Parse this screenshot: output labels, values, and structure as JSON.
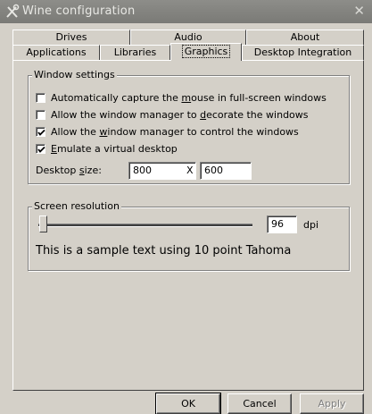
{
  "window": {
    "title": "Wine configuration",
    "close_glyph": "✕"
  },
  "tabs_row1": [
    {
      "label": "Drives"
    },
    {
      "label": "Audio"
    },
    {
      "label": "About"
    }
  ],
  "tabs_row2": [
    {
      "label": "Applications"
    },
    {
      "label": "Libraries"
    },
    {
      "label": "Graphics",
      "selected": true
    },
    {
      "label": "Desktop Integration"
    }
  ],
  "window_settings": {
    "title": "Window settings",
    "options": [
      {
        "before": "Automatically capture the ",
        "accel": "m",
        "after": "ouse in full-screen windows",
        "checked": false
      },
      {
        "before": "Allow the window manager to ",
        "accel": "d",
        "after": "ecorate the windows",
        "checked": false
      },
      {
        "before": "Allow the ",
        "accel": "w",
        "after": "indow manager to control the windows",
        "checked": true
      },
      {
        "before": "",
        "accel": "E",
        "after": "mulate a virtual desktop",
        "checked": true
      }
    ],
    "desktop_size": {
      "label_before": "Desktop ",
      "label_accel": "s",
      "label_after": "ize:",
      "width": "800",
      "separator": "X",
      "height": "600"
    }
  },
  "screen_resolution": {
    "title": "Screen resolution",
    "dpi_value": "96",
    "dpi_unit": "dpi",
    "slider_value_fraction": 0.0,
    "sample_text": "This is a sample text using 10 point Tahoma"
  },
  "buttons": {
    "ok": "OK",
    "cancel": "Cancel",
    "apply": "Apply"
  },
  "icons": {
    "title_icon": "wine-tools-icon",
    "check": "check-mark-icon"
  }
}
